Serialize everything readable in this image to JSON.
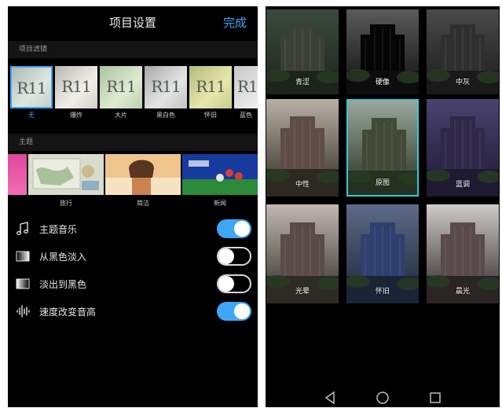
{
  "left": {
    "header": {
      "title": "项目设置",
      "done_label": "完成"
    },
    "filter_section_label": "项目滤镜",
    "filters": [
      {
        "label": "无",
        "thumb_text": "R11",
        "selected": true
      },
      {
        "label": "爆炸",
        "thumb_text": "R11"
      },
      {
        "label": "大片",
        "thumb_text": "R11"
      },
      {
        "label": "黑白色",
        "thumb_text": "R11"
      },
      {
        "label": "怀旧",
        "thumb_text": "R11"
      },
      {
        "label": "蓝色",
        "thumb_text": "R1"
      }
    ],
    "theme_section_label": "主题",
    "themes": [
      {
        "label": ""
      },
      {
        "label": "旅行"
      },
      {
        "label": "简洁"
      },
      {
        "label": "新闻"
      }
    ],
    "toggles": [
      {
        "label": "主题音乐",
        "icon": "music-note-icon",
        "on": true
      },
      {
        "label": "从黑色淡入",
        "icon": "fade-in-icon",
        "on": false
      },
      {
        "label": "淡出到黑色",
        "icon": "fade-out-icon",
        "on": false
      },
      {
        "label": "速度改变音高",
        "icon": "waveform-icon",
        "on": true
      }
    ]
  },
  "right": {
    "tiles": [
      {
        "label": "青涩"
      },
      {
        "label": "硬像"
      },
      {
        "label": "中灰"
      },
      {
        "label": "中性"
      },
      {
        "label": "原图",
        "selected": true
      },
      {
        "label": "蓝调"
      },
      {
        "label": "光晕"
      },
      {
        "label": "怀旧"
      },
      {
        "label": "晨光"
      }
    ],
    "nav": [
      "back-icon",
      "home-icon",
      "recents-icon"
    ]
  },
  "colors": {
    "accent": "#3ea6f5",
    "selected_tile_border": "#38c7d9",
    "background": "#000000"
  }
}
